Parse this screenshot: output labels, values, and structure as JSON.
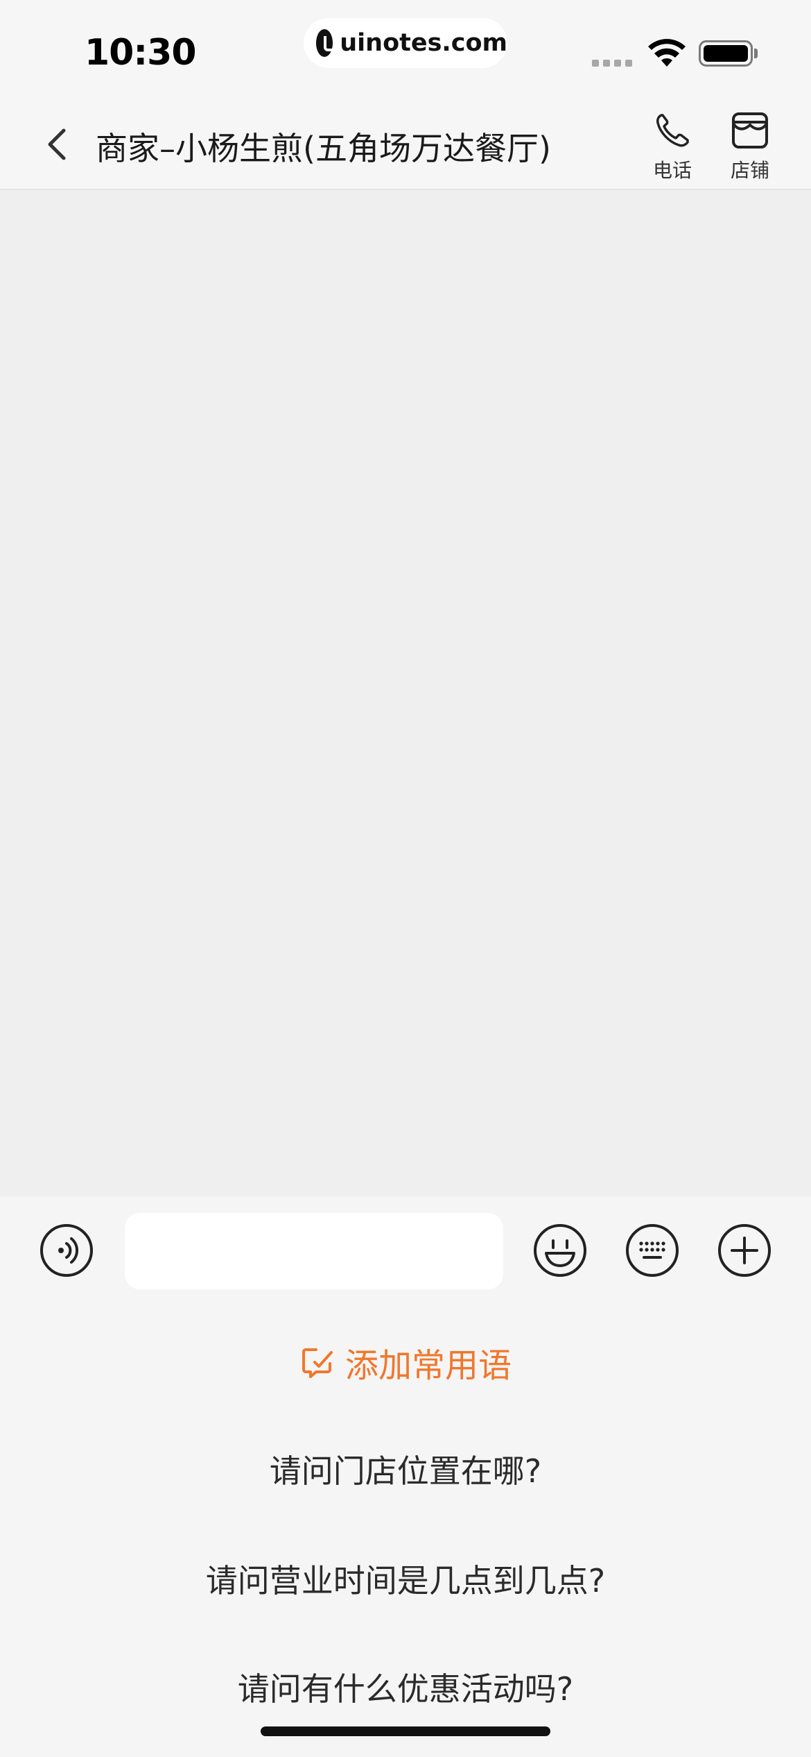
{
  "status_bar": {
    "time": "10:30",
    "url_pill": "uinotes.com"
  },
  "header": {
    "title": "商家–小杨生煎(五角场万达餐厅)",
    "actions": [
      {
        "label": "电话",
        "icon": "phone-icon"
      },
      {
        "label": "店铺",
        "icon": "store-icon"
      }
    ]
  },
  "input_bar": {
    "input_value": "",
    "input_placeholder": "",
    "buttons": [
      "voice-icon",
      "emoji-icon",
      "keyboard-icon",
      "plus-icon"
    ]
  },
  "phrases_panel": {
    "add_label": "添加常用语",
    "items": [
      "请问门店位置在哪?",
      "请问营业时间是几点到几点?",
      "请问有什么优惠活动吗?"
    ]
  },
  "colors": {
    "accent": "#f0772c",
    "background": "#efefef",
    "panel": "#f5f5f5"
  }
}
